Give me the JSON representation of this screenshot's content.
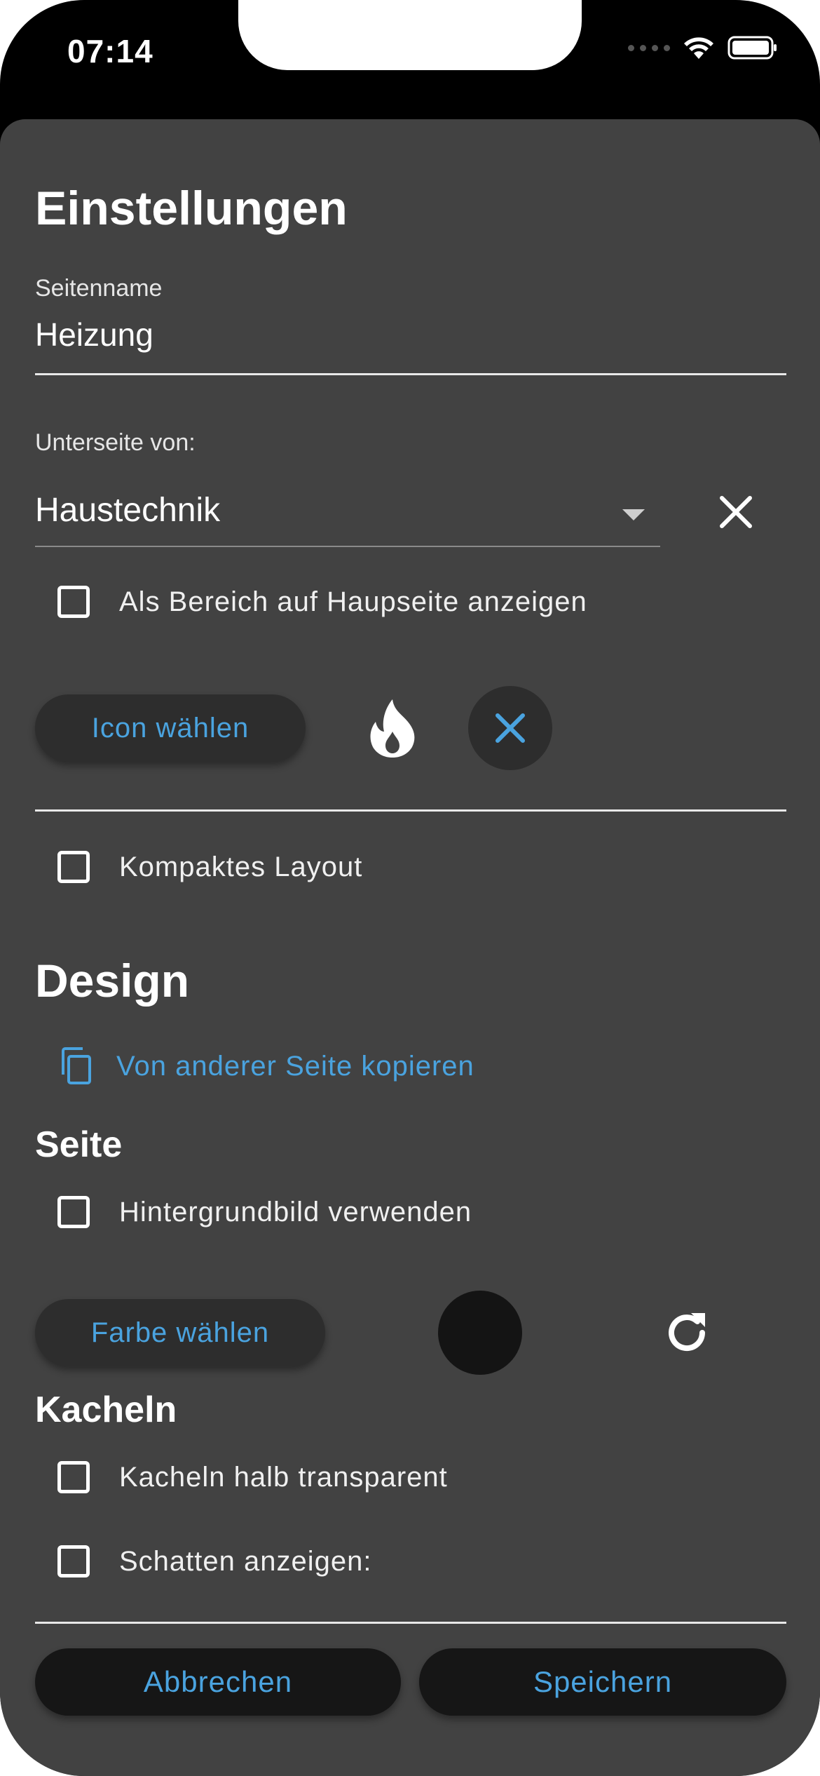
{
  "status_bar": {
    "time": "07:14"
  },
  "page": {
    "title": "Einstellungen",
    "page_name": {
      "label": "Seitenname",
      "value": "Heizung"
    },
    "parent": {
      "label": "Unterseite von:",
      "selected": "Haustechnik"
    },
    "show_as_area": {
      "label": "Als Bereich auf Haupseite anzeigen",
      "checked": false
    },
    "icon": {
      "button_label": "Icon wählen",
      "selected_icon": "flame-icon"
    },
    "compact_layout": {
      "label": "Kompaktes Layout",
      "checked": false
    }
  },
  "design": {
    "title": "Design",
    "copy_link": "Von anderer Seite kopieren",
    "seite": {
      "title": "Seite",
      "background_image": {
        "label": "Hintergrundbild verwenden",
        "checked": false
      },
      "color_button_label": "Farbe wählen",
      "color": "#141414"
    },
    "kacheln": {
      "title": "Kacheln",
      "semi_transparent": {
        "label": "Kacheln halb transparent",
        "checked": false
      },
      "show_shadow": {
        "label": "Schatten anzeigen:",
        "checked": false
      }
    }
  },
  "footer": {
    "cancel_label": "Abbrechen",
    "save_label": "Speichern"
  },
  "colors": {
    "accent": "#4aa3df",
    "sheet": "#424242",
    "button": "#2d2d2d"
  }
}
